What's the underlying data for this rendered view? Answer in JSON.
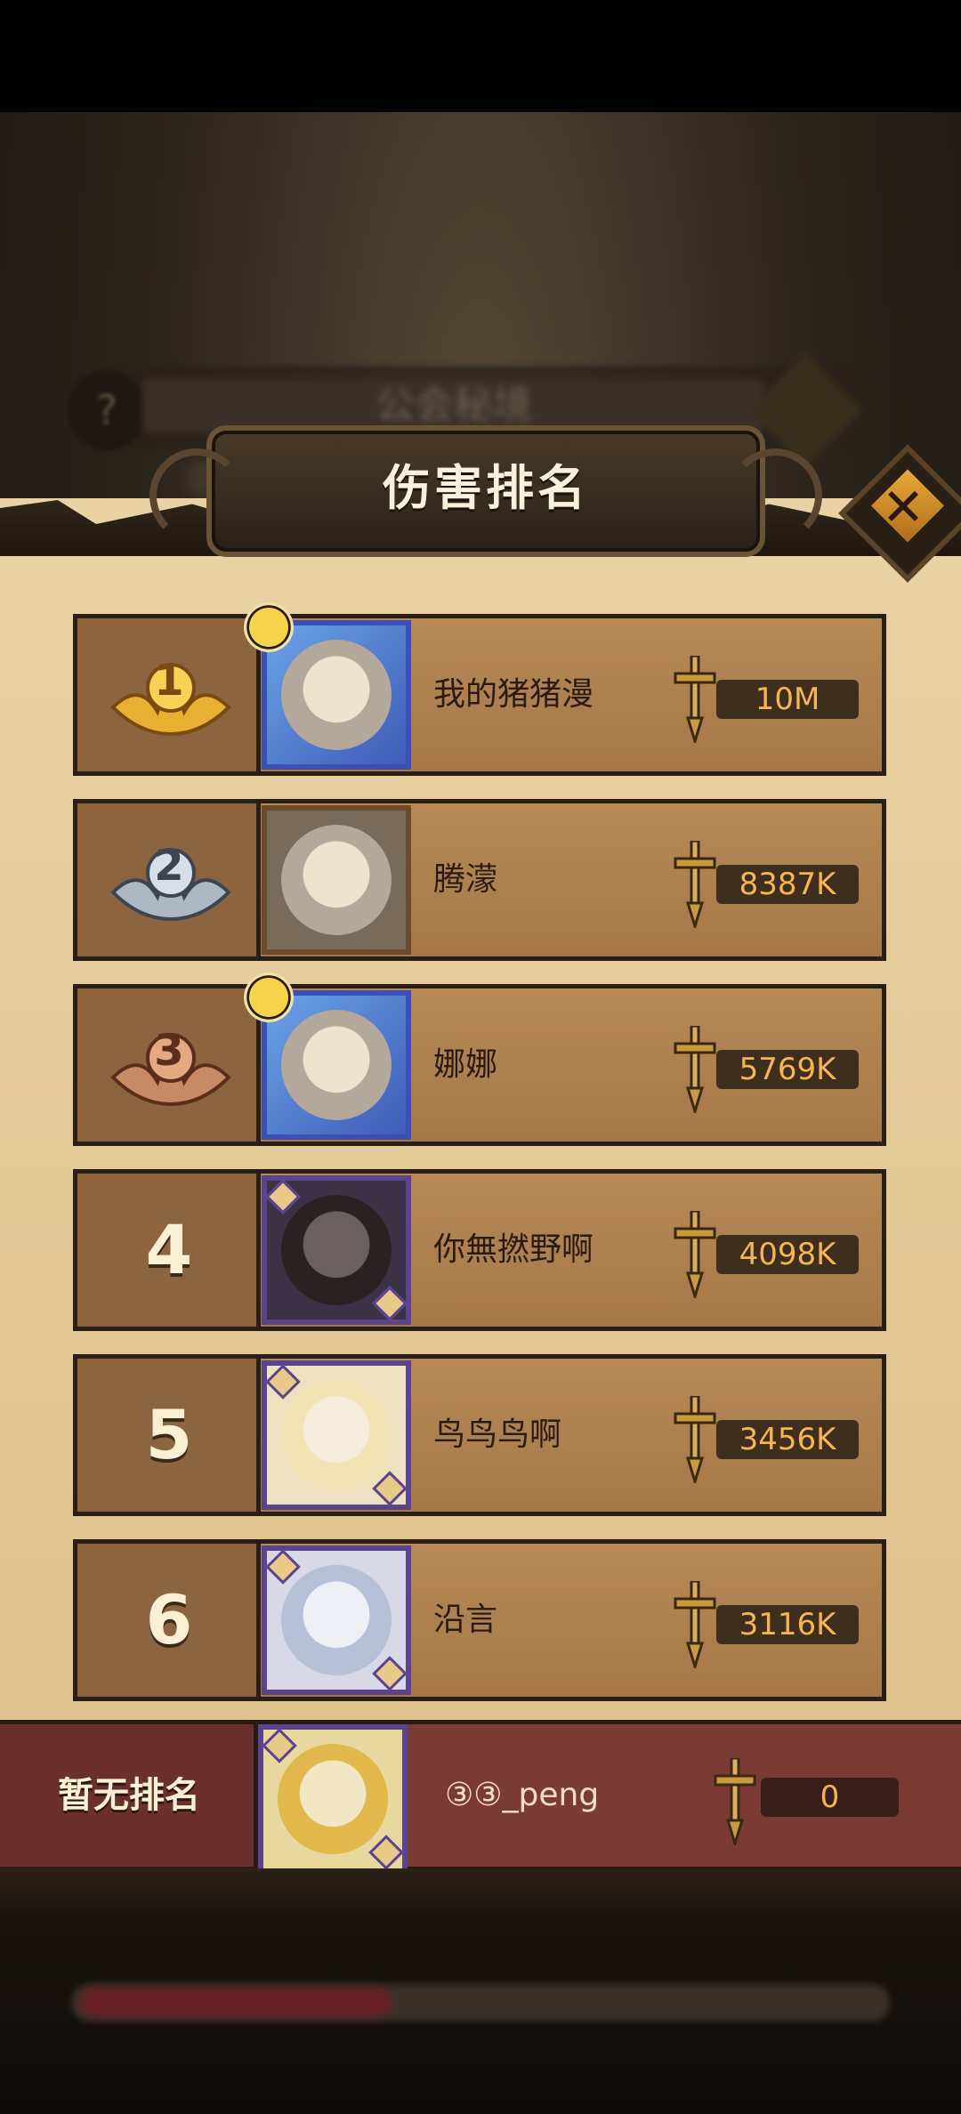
{
  "background": {
    "title_blur": "公会秘境"
  },
  "dialog": {
    "title": "伤害排名",
    "close_label": "✕"
  },
  "rankings": [
    {
      "rank": "1",
      "medal": "gold",
      "name": "我的猪猪漫",
      "score": "10M"
    },
    {
      "rank": "2",
      "medal": "silver",
      "name": "腾濛",
      "score": "8387K"
    },
    {
      "rank": "3",
      "medal": "bronze",
      "name": "娜娜",
      "score": "5769K"
    },
    {
      "rank": "4",
      "medal": "",
      "name": "你無撚野啊",
      "score": "4098K"
    },
    {
      "rank": "5",
      "medal": "",
      "name": "鸟鸟鸟啊",
      "score": "3456K"
    },
    {
      "rank": "6",
      "medal": "",
      "name": "沿言",
      "score": "3116K"
    }
  ],
  "self": {
    "rank_label": "暂无排名",
    "name": "③③_peng",
    "score": "0"
  },
  "colors": {
    "panel": "#e9d2a4",
    "row": "#a87c4d",
    "score_text": "#f3b650",
    "self_row": "#7b3b35"
  }
}
